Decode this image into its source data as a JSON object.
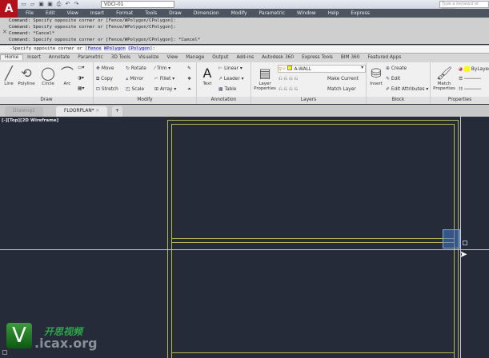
{
  "app": {
    "logo": "A",
    "workspace": "VDCI-01",
    "search_placeholder": "Type a keyword or phrase"
  },
  "menu": [
    "File",
    "Edit",
    "View",
    "Insert",
    "Format",
    "Tools",
    "Draw",
    "Dimension",
    "Modify",
    "Parametric",
    "Window",
    "Help",
    "Express"
  ],
  "command_history": [
    "Command: Specify opposite corner or [Fence/WPolygon/CPolygon]:",
    "Command: Specify opposite corner or [Fence/WPolygon/CPolygon]:",
    "Command: *Cancel*",
    "Command: Specify opposite corner or [Fence/WPolygon/CPolygon]: *Cancel*"
  ],
  "command_line": {
    "prompt": "-Specify opposite corner or [",
    "opt1": "Fence",
    "opt2": "WPolygon",
    "opt3": "CPolygon",
    "end": "]:"
  },
  "ribbon_tabs": [
    "Home",
    "Insert",
    "Annotate",
    "Parametric",
    "3D Tools",
    "Visualize",
    "View",
    "Manage",
    "Output",
    "Add-ins",
    "Autodesk 360",
    "Express Tools",
    "BIM 360",
    "Featured Apps"
  ],
  "ribbon": {
    "draw": {
      "title": "Draw",
      "line": "Line",
      "polyline": "Polyline",
      "circle": "Circle",
      "arc": "Arc"
    },
    "modify": {
      "title": "Modify",
      "move": "Move",
      "rotate": "Rotate",
      "trim": "Trim",
      "copy": "Copy",
      "mirror": "Mirror",
      "fillet": "Fillet",
      "stretch": "Stretch",
      "scale": "Scale",
      "array": "Array"
    },
    "annotation": {
      "title": "Annotation",
      "text": "Text",
      "linear": "Linear",
      "leader": "Leader",
      "table": "Table"
    },
    "layers": {
      "title": "Layers",
      "layer_properties": "Layer Properties",
      "current_layer": "A-WALL",
      "make_current": "Make Current",
      "match_layer": "Match Layer"
    },
    "block": {
      "title": "Block",
      "insert": "Insert",
      "create": "Create",
      "edit": "Edit",
      "edit_attributes": "Edit Attributes"
    },
    "properties": {
      "title": "Properties",
      "match_properties": "Match Properties",
      "color": "ByLayer"
    }
  },
  "file_tabs": [
    {
      "label": "Drawing1"
    },
    {
      "label": "FLOORPLAN*"
    }
  ],
  "viewport_label": "[-][Top][2D Wireframe]",
  "watermark": {
    "letter": "V",
    "chinese": "开思视频",
    "url": ".icax.org"
  },
  "colors": {
    "wall": "#b8b45a",
    "layer_swatch": "#ffff00",
    "background": "#252b38"
  }
}
